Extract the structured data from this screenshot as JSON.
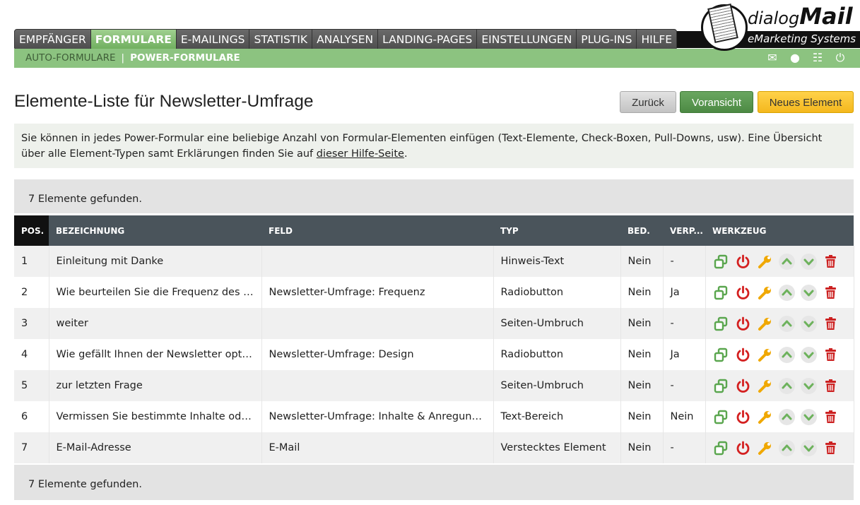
{
  "nav": {
    "items": [
      "EMPFÄNGER",
      "FORMULARE",
      "E-MAILINGS",
      "STATISTIK",
      "ANALYSEN",
      "LANDING-PAGES",
      "EINSTELLUNGEN",
      "PLUG-INS",
      "HILFE"
    ],
    "active": 1
  },
  "subnav": {
    "items": [
      "AUTO-FORMULARE",
      "POWER-FORMULARE"
    ],
    "active": 1
  },
  "logo": {
    "dialog": "dialog",
    "mail": "Mail",
    "sub": "eMarketing Systems"
  },
  "page": {
    "title": "Elemente-Liste für Newsletter-Umfrage"
  },
  "buttons": {
    "back": "Zurück",
    "preview": "Voransicht",
    "new": "Neues Element"
  },
  "info": {
    "text_before": "Sie können in jedes Power-Formular eine beliebige Anzahl von Formular-Elementen einfügen (Text-Elemente, Check-Boxen, Pull-Downs, usw). Eine Übersicht über alle Element-Typen samt Erklärungen finden Sie auf ",
    "link": "dieser Hilfe-Seite",
    "text_after": "."
  },
  "found_text": "7 Elemente gefunden.",
  "table": {
    "headers": {
      "pos": "POS.",
      "name": "BEZEICHNUNG",
      "field": "FELD",
      "type": "TYP",
      "req": "BED.",
      "hidden": "VERP...",
      "tools": "WERKZEUG"
    },
    "rows": [
      {
        "pos": "1",
        "name": "Einleitung mit Danke",
        "field": "",
        "type": "Hinweis-Text",
        "req": "Nein",
        "hidden": "-"
      },
      {
        "pos": "2",
        "name": "Wie beurteilen Sie die Frequenz des N...",
        "field": "Newsletter-Umfrage: Frequenz",
        "type": "Radiobutton",
        "req": "Nein",
        "hidden": "Ja"
      },
      {
        "pos": "3",
        "name": "weiter",
        "field": "",
        "type": "Seiten-Umbruch",
        "req": "Nein",
        "hidden": "-"
      },
      {
        "pos": "4",
        "name": "Wie gefällt Ihnen der Newsletter optisc...",
        "field": "Newsletter-Umfrage: Design",
        "type": "Radiobutton",
        "req": "Nein",
        "hidden": "Ja"
      },
      {
        "pos": "5",
        "name": "zur letzten Frage",
        "field": "",
        "type": "Seiten-Umbruch",
        "req": "Nein",
        "hidden": "-"
      },
      {
        "pos": "6",
        "name": "Vermissen Sie bestimmte Inhalte oder ...",
        "field": "Newsletter-Umfrage: Inhalte & Anregungen",
        "type": "Text-Bereich",
        "req": "Nein",
        "hidden": "Nein"
      },
      {
        "pos": "7",
        "name": "E-Mail-Adresse",
        "field": "E-Mail",
        "type": "Verstecktes Element",
        "req": "Nein",
        "hidden": "-"
      }
    ]
  },
  "icons": {
    "copy": "copy-icon",
    "power": "power-icon",
    "edit": "wrench-icon",
    "up": "arrow-up-icon",
    "down": "arrow-down-icon",
    "delete": "trash-icon",
    "mail": "mail-icon",
    "user": "user-icon",
    "sitemap": "sitemap-icon",
    "logout": "logout-icon"
  },
  "colors": {
    "nav_active": "#7fbf6e",
    "subbar": "#8cc380",
    "header_dark": "#4a545b",
    "power": "#d42020",
    "copy": "#5aa64e",
    "wrench": "#f0a800",
    "arrow": "#6db25c",
    "trash": "#cc2222",
    "btn_new": "#f6bd24",
    "btn_preview": "#5a9a50"
  }
}
